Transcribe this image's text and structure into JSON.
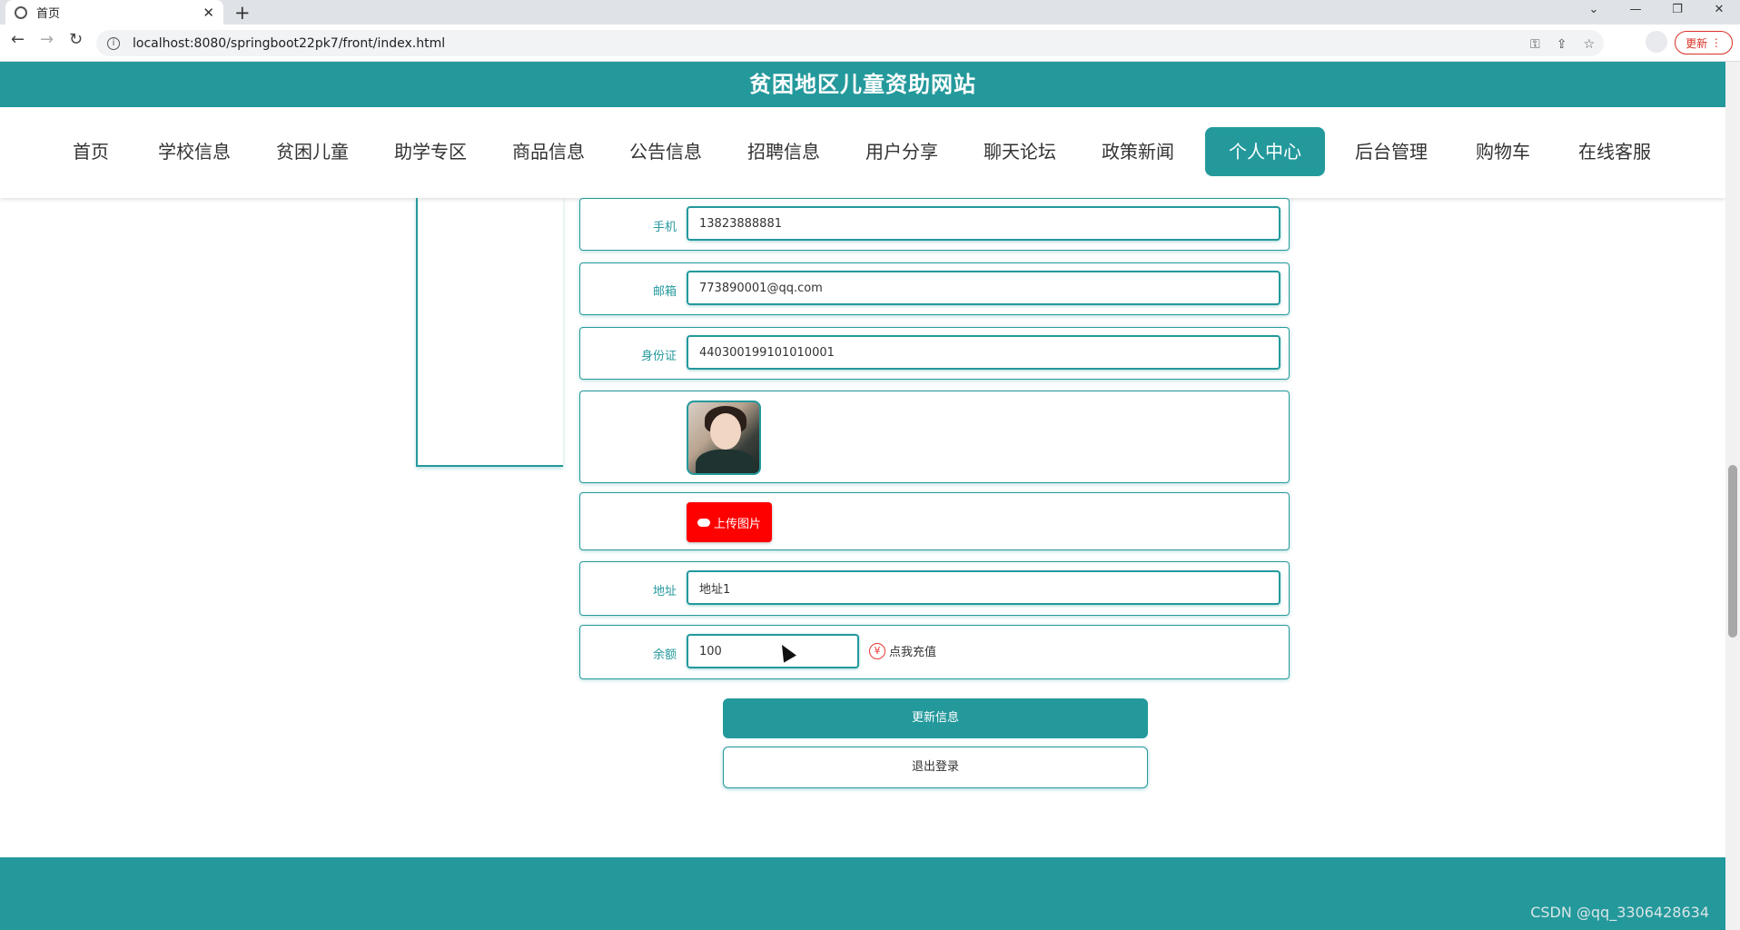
{
  "browser": {
    "tab_title": "首页",
    "new_tab": "+",
    "url": "localhost:8080/springboot22pk7/front/index.html",
    "update_label": "更新"
  },
  "site": {
    "title": "贫困地区儿童资助网站"
  },
  "nav": {
    "items": [
      "首页",
      "学校信息",
      "贫困儿童",
      "助学专区",
      "商品信息",
      "公告信息",
      "招聘信息",
      "用户分享",
      "聊天论坛",
      "政策新闻",
      "个人中心",
      "后台管理",
      "购物车",
      "在线客服"
    ],
    "active": "个人中心"
  },
  "form": {
    "phone_label": "手机",
    "phone_value": "13823888881",
    "email_label": "邮箱",
    "email_value": "773890001@qq.com",
    "idcard_label": "身份证",
    "idcard_value": "440300199101010001",
    "upload_label": "上传图片",
    "address_label": "地址",
    "address_value": "地址1",
    "balance_label": "余额",
    "balance_value": "100",
    "recharge_label": "点我充值"
  },
  "actions": {
    "update": "更新信息",
    "logout": "退出登录"
  },
  "footer": {
    "watermark": "CSDN @qq_3306428634"
  },
  "colors": {
    "primary": "#24999c",
    "upload": "#ff0000"
  }
}
